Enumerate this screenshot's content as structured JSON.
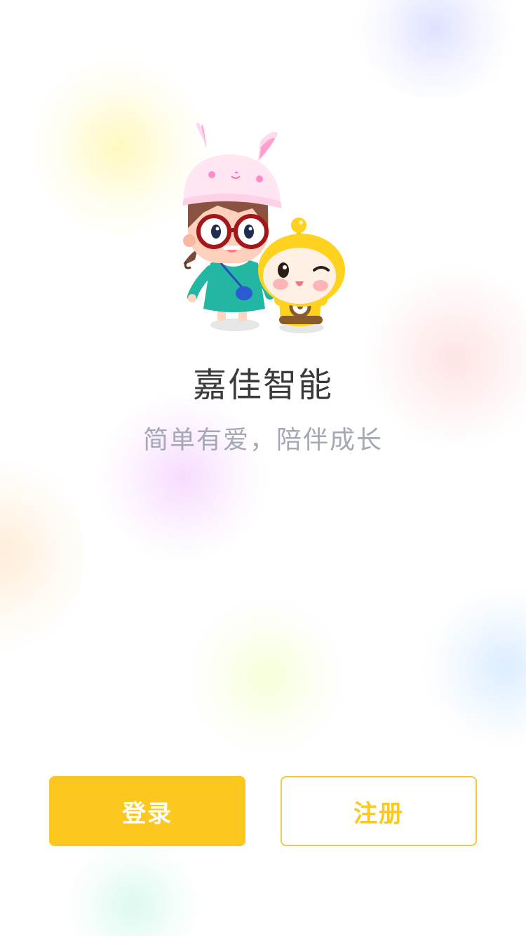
{
  "app": {
    "title": "嘉佳智能",
    "slogan": "简单有爱，陪伴成长"
  },
  "actions": {
    "login_label": "登录",
    "register_label": "注册"
  },
  "illustration": {
    "icon": "mascot-girl-and-robot-illustration"
  },
  "colors": {
    "accent": "#fcc71e",
    "title_text": "#3a3a3a",
    "slogan_text": "#a3a8b4",
    "background": "#ffffff"
  }
}
